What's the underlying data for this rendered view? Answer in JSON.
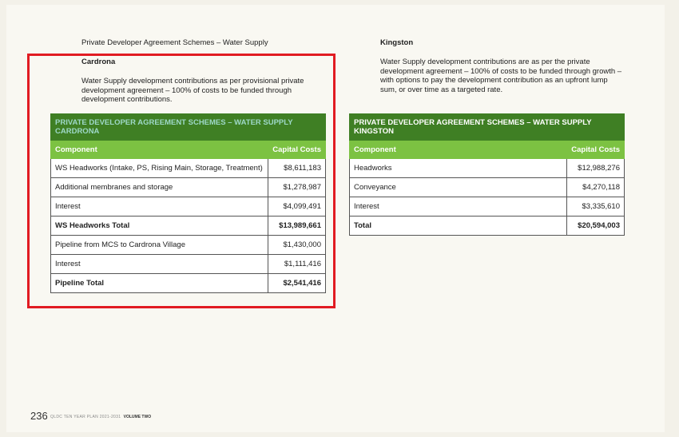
{
  "left": {
    "section_title": "Private Developer Agreement Schemes – Water Supply",
    "heading": "Cardrona",
    "paragraph": "Water Supply development contributions as per provisional private development agreement – 100% of costs to be funded through development contributions.",
    "table": {
      "title_line1": "PRIVATE DEVELOPER AGREEMENT SCHEMES – WATER SUPPLY",
      "title_line2": "CARDRONA",
      "col1": "Component",
      "col2": "Capital Costs",
      "rows": [
        {
          "component": "WS Headworks (Intake, PS, Rising Main, Storage, Treatment)",
          "cost": "$8,611,183",
          "total": false
        },
        {
          "component": "Additional membranes and storage",
          "cost": "$1,278,987",
          "total": false
        },
        {
          "component": "Interest",
          "cost": "$4,099,491",
          "total": false
        },
        {
          "component": "WS Headworks Total",
          "cost": "$13,989,661",
          "total": true
        },
        {
          "component": "Pipeline from MCS to Cardrona Village",
          "cost": "$1,430,000",
          "total": false
        },
        {
          "component": "Interest",
          "cost": "$1,111,416",
          "total": false
        },
        {
          "component": "Pipeline Total",
          "cost": "$2,541,416",
          "total": true
        }
      ]
    }
  },
  "right": {
    "heading": "Kingston",
    "paragraph": "Water Supply development contributions are as per the private development agreement – 100% of costs to be funded through growth – with options to pay the development contribution as an upfront lump sum, or over time as a targeted rate.",
    "table": {
      "title_line1": "PRIVATE DEVELOPER AGREEMENT SCHEMES – WATER SUPPLY",
      "title_line2": "KINGSTON",
      "col1": "Component",
      "col2": "Capital Costs",
      "rows": [
        {
          "component": "Headworks",
          "cost": "$12,988,276",
          "total": false
        },
        {
          "component": "Conveyance",
          "cost": "$4,270,118",
          "total": false
        },
        {
          "component": "Interest",
          "cost": "$3,335,610",
          "total": false
        },
        {
          "component": "Total",
          "cost": "$20,594,003",
          "total": true
        }
      ]
    }
  },
  "footer": {
    "page_number": "236",
    "plan": "QLDC TEN YEAR PLAN 2021-2031",
    "volume": "VOLUME TWO"
  },
  "colors": {
    "title_bar": "#3f7f24",
    "header_bar": "#7cc242",
    "highlight_box": "#e11b22"
  }
}
